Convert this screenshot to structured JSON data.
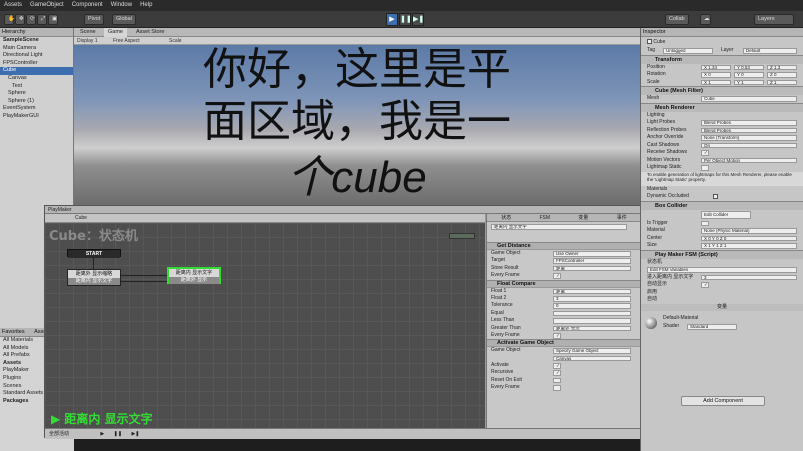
{
  "menubar": {
    "items": [
      "Assets",
      "GameObject",
      "Component",
      "Window",
      "Help"
    ]
  },
  "toolbar": {
    "pivot_label": "Pivot",
    "global_label": "Global",
    "collab_label": "Collab",
    "layers_label": "Layers"
  },
  "hierarchy": {
    "tab_label": "Hierarchy",
    "rows": [
      {
        "label": "SampleScene",
        "style": "bold"
      },
      {
        "label": "Main Camera",
        "style": ""
      },
      {
        "label": "Directional Light",
        "style": ""
      },
      {
        "label": "FPSController",
        "style": ""
      },
      {
        "label": "Cube",
        "style": "sel"
      },
      {
        "label": "Canvas",
        "style": ""
      },
      {
        "label": "Text",
        "style": ""
      },
      {
        "label": "Sphere",
        "style": ""
      },
      {
        "label": "Sphere (1)",
        "style": ""
      },
      {
        "label": "EventSystem",
        "style": ""
      },
      {
        "label": "PlayMakerGUI",
        "style": ""
      }
    ]
  },
  "project": {
    "tabs": [
      "Favorites",
      "Assets"
    ],
    "rows": [
      "All Materials",
      "All Models",
      "All Prefabs",
      "Assets",
      "PlayMaker",
      "Plugins",
      "Scenes",
      "Standard Assets",
      "Packages"
    ]
  },
  "game_view": {
    "tabs": [
      "Scene",
      "Game",
      "Asset Store"
    ],
    "bar_display": "Display 1",
    "bar_aspect": "Free Aspect",
    "bar_scale": "Scale",
    "lines": [
      "你好，这里是平",
      "面区域，我是一",
      "个cube"
    ]
  },
  "playmaker": {
    "title": "PlayMaker",
    "toolbar_target": "Cube",
    "fsm_title": "Cube：状态机",
    "start_label": "START",
    "state1": {
      "title": "距离外 显示缩略",
      "event": "距离内 显示文字"
    },
    "state2": {
      "title": "距离内 显示文字",
      "event": "距离外 显示"
    },
    "hint": "▶ 距离内 显示文字",
    "footer_label": "全部活动"
  },
  "state_inspector": {
    "tabs": [
      "状态",
      "FSM",
      "变量",
      "事件"
    ],
    "state_name": "距离内 显示文字",
    "sections": [
      {
        "title": "Get Distance",
        "fields": [
          {
            "label": "Game Object",
            "value": "Use Owner"
          },
          {
            "label": "Target",
            "value": "FPSController"
          },
          {
            "label": "Store Result",
            "value": "距离"
          },
          {
            "label": "Every Frame",
            "value": "✓"
          }
        ]
      },
      {
        "title": "Float Compare",
        "fields": [
          {
            "label": "Float 1",
            "value": "距离"
          },
          {
            "label": "Float 2",
            "value": "3"
          },
          {
            "label": "Tolerance",
            "value": "0"
          },
          {
            "label": "Equal",
            "value": ""
          },
          {
            "label": "Less Than",
            "value": ""
          },
          {
            "label": "Greater Than",
            "value": "距离外 显示"
          },
          {
            "label": "Every Frame",
            "value": "✓"
          }
        ]
      },
      {
        "title": "Activate Game Object",
        "fields": [
          {
            "label": "Game Object",
            "value": "Specify Game Object"
          },
          {
            "label": "",
            "value": "Canvas"
          },
          {
            "label": "Activate",
            "value": "✓"
          },
          {
            "label": "Recursive",
            "value": "✓"
          },
          {
            "label": "Reset On Exit",
            "value": ""
          },
          {
            "label": "Every Frame",
            "value": ""
          }
        ]
      }
    ]
  },
  "inspector": {
    "tab_label": "Inspector",
    "object_name": "Cube",
    "tag_label": "Tag",
    "tag_value": "Untagged",
    "layer_label": "Layer",
    "layer_value": "Default",
    "transform_title": "Transform",
    "transform_rows": [
      {
        "label": "Position",
        "x": "X 1.34",
        "y": "Y 0.53",
        "z": "Z 1.3"
      },
      {
        "label": "Rotation",
        "x": "X 0",
        "y": "Y 0",
        "z": "Z 0"
      },
      {
        "label": "Scale",
        "x": "X 1",
        "y": "Y 1",
        "z": "Z 1"
      }
    ],
    "meshfilter_title": "Cube (Mesh Filter)",
    "mesh_label": "Mesh",
    "mesh_value": "Cube",
    "renderer_title": "Mesh Renderer",
    "renderer_rows": [
      {
        "label": "Lighting",
        "value": ""
      },
      {
        "label": "Light Probes",
        "value": "Blend Probes"
      },
      {
        "label": "Reflection Probes",
        "value": "Blend Probes"
      },
      {
        "label": "Anchor Override",
        "value": "None (Transform)"
      },
      {
        "label": "Cast Shadows",
        "value": "On"
      },
      {
        "label": "Receive Shadows",
        "value": "✓"
      },
      {
        "label": "Motion Vectors",
        "value": "Per Object Motion"
      },
      {
        "label": "Lightmap Static",
        "value": ""
      }
    ],
    "lightmap_note": "To enable generation of lightmaps for this Mesh Renderer, please enable the 'Lightmap Static' property.",
    "materials_label": "Materials",
    "dynamic_label": "Dynamic Occluded",
    "collider_title": "Box Collider",
    "collider_edit": "Edit Collider",
    "collider_rows": [
      {
        "label": "Is Trigger",
        "value": ""
      },
      {
        "label": "Material",
        "value": "None (Physic Material)"
      },
      {
        "label": "Center",
        "value": "X 0  Y 0  Z 0"
      },
      {
        "label": "Size",
        "value": "X 1  Y 1  Z 1"
      }
    ],
    "fsm_component_title": "Play Maker FSM (Script)",
    "fsm_rows": [
      {
        "label": "状态机",
        "value": ""
      },
      {
        "label": "",
        "value": "Edit FSM Variables"
      },
      {
        "label": "进入距离内 显示文字",
        "value": "3"
      },
      {
        "label": "自动显示",
        "value": "✓"
      },
      {
        "label": "启用",
        "value": ""
      },
      {
        "label": "自动",
        "value": ""
      }
    ],
    "variables_label": "变量",
    "material_name": "Default-Material",
    "shader_label": "Shader",
    "shader_value": "Standard",
    "add_component": "Add Component"
  }
}
